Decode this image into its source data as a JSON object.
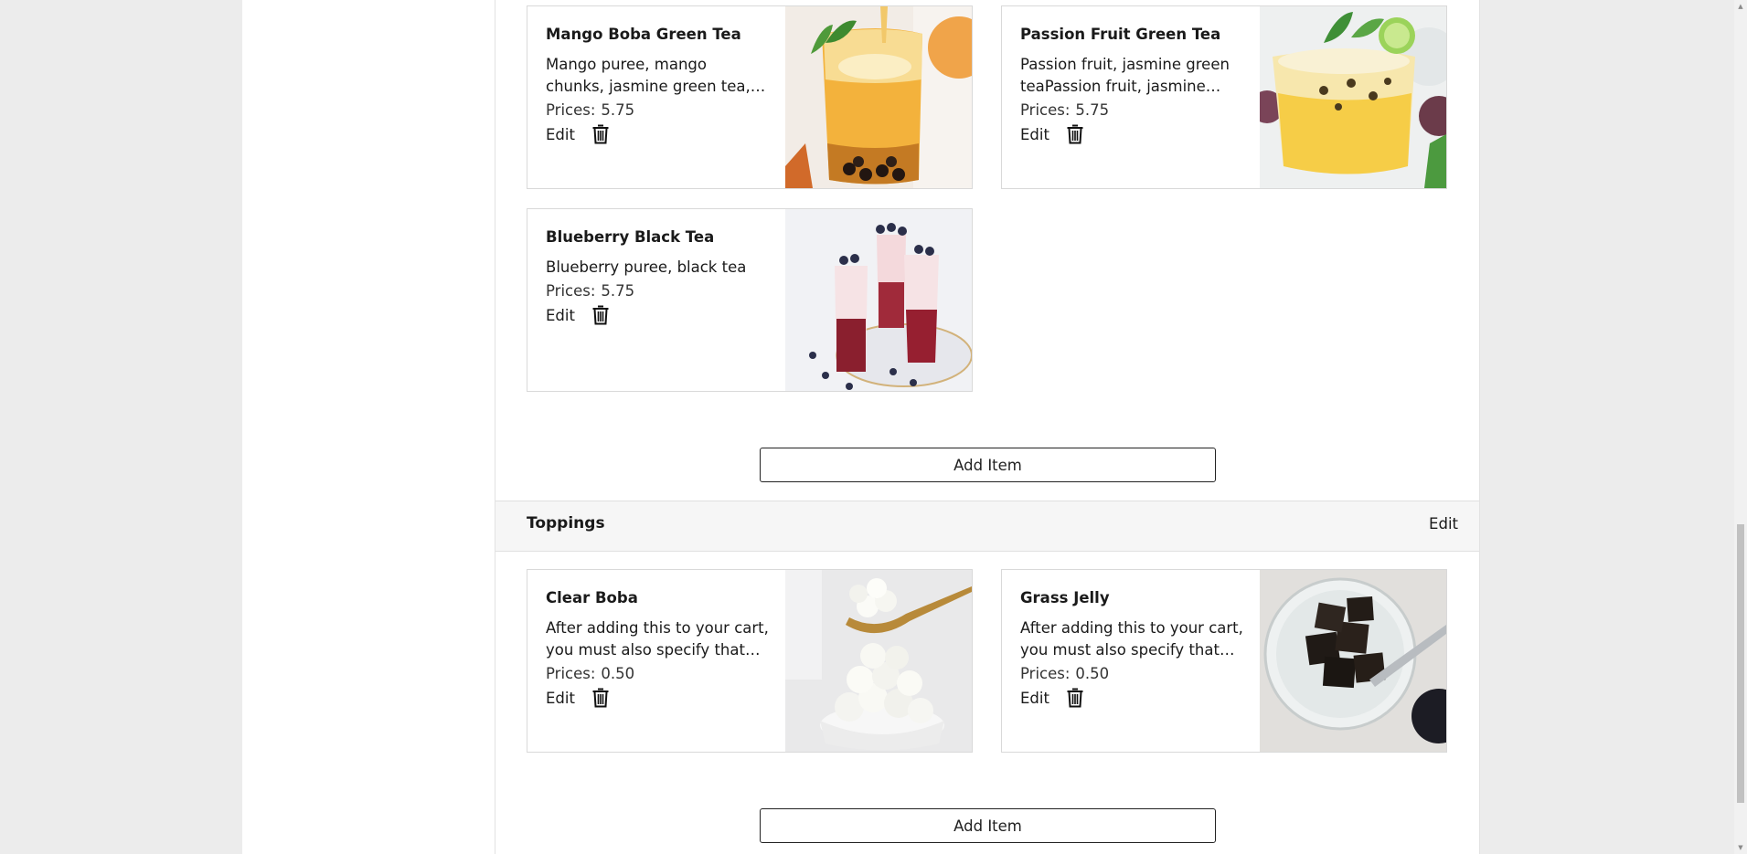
{
  "categories": [
    {
      "items": [
        {
          "name": "Mango Boba Green Tea",
          "description": "Mango puree, mango chunks, jasmine green tea, boba",
          "price_label": "Prices:",
          "price": "5.75",
          "edit_label": "Edit"
        },
        {
          "name": "Passion Fruit Green Tea",
          "description": "Passion fruit, jasmine green teaPassion fruit, jasmine green tea",
          "price_label": "Prices:",
          "price": "5.75",
          "edit_label": "Edit"
        },
        {
          "name": "Blueberry Black Tea",
          "description": "Blueberry puree, black tea",
          "price_label": "Prices:",
          "price": "5.75",
          "edit_label": "Edit"
        }
      ],
      "add_item_label": "Add Item"
    },
    {
      "title": "Toppings",
      "edit_label": "Edit",
      "items": [
        {
          "name": "Clear Boba",
          "description": "After adding this to your cart, you must also specify that you would like this topping added to your drink",
          "price_label": "Prices:",
          "price": "0.50",
          "edit_label": "Edit"
        },
        {
          "name": "Grass Jelly",
          "description": "After adding this to your cart, you must also specify that you would like this topping added to your drink",
          "price_label": "Prices:",
          "price": "0.50",
          "edit_label": "Edit"
        }
      ],
      "add_item_label": "Add Item"
    }
  ],
  "icons": {
    "delete": "trash-icon",
    "scroll_up": "scroll-up-arrow",
    "scroll_down": "scroll-down-arrow"
  },
  "colors": {
    "gutter": "#ececec",
    "section_header_bg": "#f6f6f6",
    "card_border": "#d9d9d9"
  }
}
